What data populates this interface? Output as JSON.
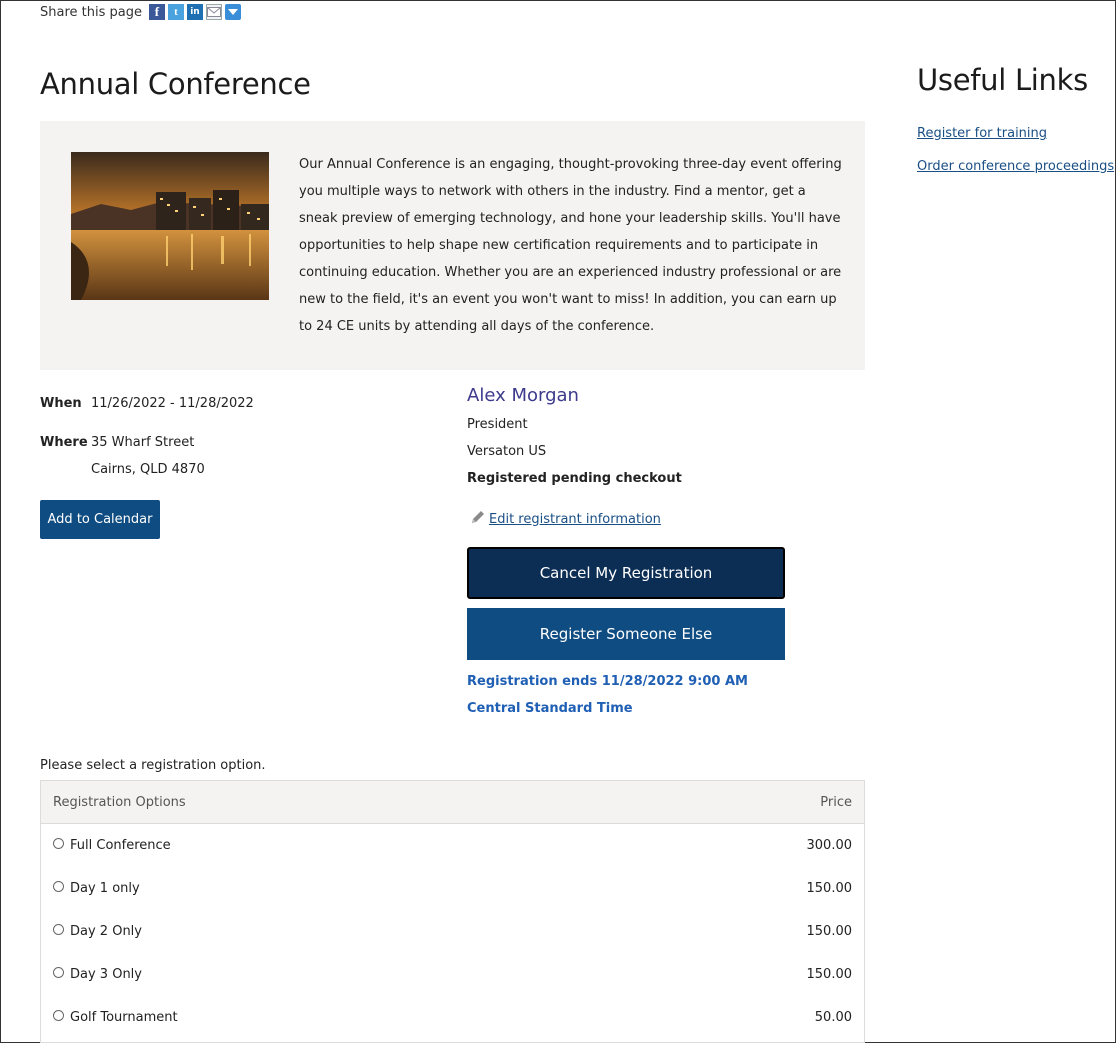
{
  "share": {
    "label": "Share this page",
    "icons": [
      "facebook-icon",
      "twitter-icon",
      "linkedin-icon",
      "email-icon",
      "more-share-icon"
    ]
  },
  "event": {
    "title": "Annual Conference",
    "description": "Our Annual Conference is an engaging, thought-provoking three-day event offering you multiple ways to network with others in the industry. Find a mentor, get a sneak preview of emerging technology, and hone your leadership skills. You'll have opportunities to help shape new certification requirements and to participate in continuing education. Whether you are an experienced industry professional or are new to the field, it's an event you won't want to miss! In addition, you can earn up to 24 CE units by attending all days of the conference.",
    "when_label": "When",
    "when_value": "11/26/2022 - 11/28/2022",
    "where_label": "Where",
    "where_line1": "35 Wharf Street",
    "where_line2": "Cairns, QLD 4870",
    "add_calendar_label": "Add to Calendar"
  },
  "registrant": {
    "name": "Alex Morgan",
    "role": "President",
    "company": "Versaton US",
    "status": "Registered pending checkout",
    "edit_label": "Edit registrant information",
    "cancel_label": "Cancel My Registration",
    "register_else_label": "Register Someone Else",
    "registration_ends": "Registration ends 11/28/2022 9:00 AM",
    "timezone": "Central Standard Time"
  },
  "options": {
    "prompt": "Please select a registration option.",
    "header_option": "Registration Options",
    "header_price": "Price",
    "rows": [
      {
        "label": "Full Conference",
        "price": "300.00"
      },
      {
        "label": "Day 1 only",
        "price": "150.00"
      },
      {
        "label": "Day 2 Only",
        "price": "150.00"
      },
      {
        "label": "Day 3 Only",
        "price": "150.00"
      },
      {
        "label": "Golf Tournament",
        "price": "50.00"
      }
    ]
  },
  "useful_links": {
    "title": "Useful Links",
    "items": [
      "Register for training",
      "Order conference proceedings"
    ]
  },
  "colors": {
    "primary_button": "#0f4c81",
    "cancel_button": "#0c2e55",
    "registrant_name": "#3d3a8c",
    "deadline_text": "#1f5fb4",
    "panel_bg": "#f4f3f1"
  }
}
